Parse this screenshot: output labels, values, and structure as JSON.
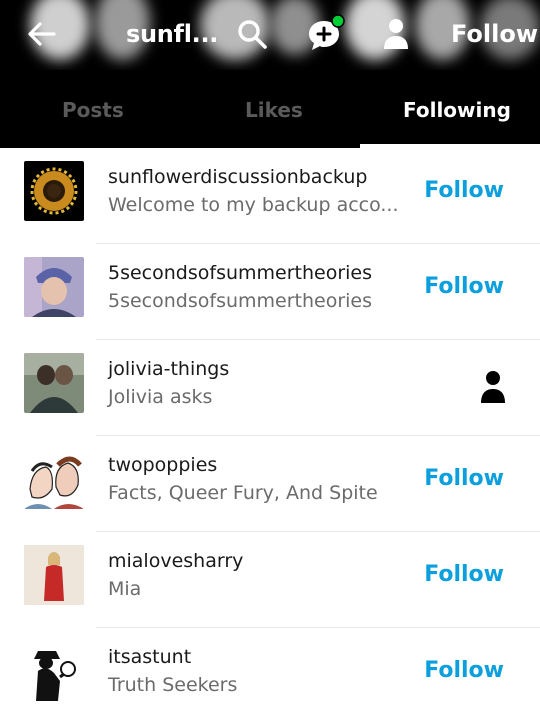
{
  "header": {
    "blog_title": "sunfl...",
    "follow_label": "Follow",
    "notification_color": "#00cf35"
  },
  "tabs": [
    {
      "label": "Posts",
      "active": false
    },
    {
      "label": "Likes",
      "active": false
    },
    {
      "label": "Following",
      "active": true
    }
  ],
  "following": [
    {
      "name": "sunflowerdiscussionbackup",
      "description": "Welcome to my backup acco...",
      "action": "Follow"
    },
    {
      "name": "5secondsofsummertheories",
      "description": "5secondsofsummertheories",
      "action": "Follow"
    },
    {
      "name": "jolivia-things",
      "description": "Jolivia asks",
      "action": "person-icon"
    },
    {
      "name": "twopoppies",
      "description": "Facts, Queer Fury, And Spite",
      "action": "Follow"
    },
    {
      "name": "mialovesharry",
      "description": "Mia",
      "action": "Follow"
    },
    {
      "name": "itsastunt",
      "description": "Truth Seekers",
      "action": "Follow"
    }
  ],
  "colors": {
    "accent_follow": "#0b9fdd",
    "header_bg": "#000000"
  }
}
